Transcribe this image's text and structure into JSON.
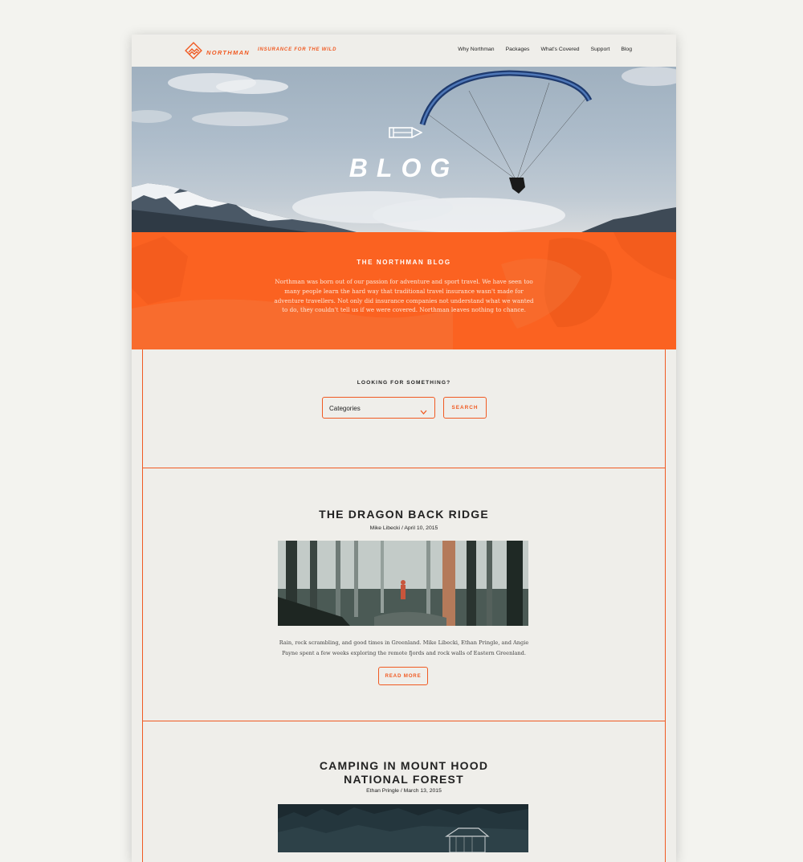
{
  "brand": {
    "name": "NORTHMAN",
    "tagline": "INSURANCE FOR THE WILD",
    "accent": "#f05a22",
    "orange_band": "#fb6221"
  },
  "nav": {
    "items": [
      {
        "label": "Why Northman"
      },
      {
        "label": "Packages"
      },
      {
        "label": "What's Covered"
      },
      {
        "label": "Support"
      },
      {
        "label": "Blog"
      }
    ]
  },
  "hero": {
    "title": "BLOG",
    "icon": "pencil-icon"
  },
  "intro": {
    "heading": "THE NORTHMAN BLOG",
    "text": "Northman was born out of our passion for adventure and sport travel. We have seen too many people learn the hard way that traditional travel insurance wasn't made for adventure travellers. Not only did insurance companies not understand what we wanted to do, they couldn't tell us if we were covered. Northman leaves nothing to chance."
  },
  "search": {
    "label": "LOOKING FOR SOMETHING?",
    "select_value": "Categories",
    "button_label": "SEARCH"
  },
  "posts": [
    {
      "title": "THE DRAGON BACK RIDGE",
      "meta": "Mike Libecki / April 10, 2015",
      "excerpt": "Rain, rock scrambling, and good times in Greenland. Mike Libecki, Ethan Pringle, and Angie Payne spent a few weeks exploring the remote fjords and rock walls of Eastern Greenland.",
      "read_more": "READ MORE"
    },
    {
      "title_line1": "CAMPING IN MOUNT HOOD",
      "title_line2": "NATIONAL FOREST",
      "meta": "Ethan Pringle / March 13, 2015"
    }
  ]
}
